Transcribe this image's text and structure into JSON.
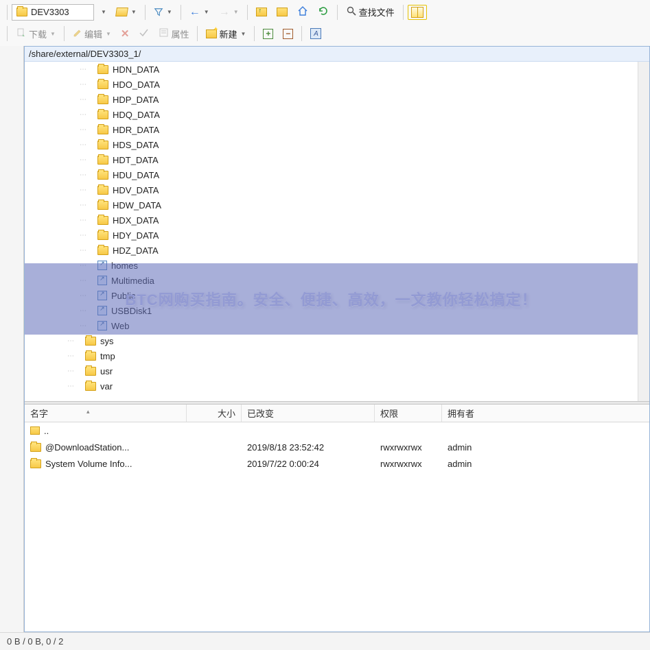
{
  "toolbar": {
    "path_dropdown": "DEV3303",
    "find_label": "查找文件",
    "download_label": "下载",
    "edit_label": "编辑",
    "props_label": "属性",
    "new_label": "新建",
    "a_label": "A"
  },
  "pathbar": "/share/external/DEV3303_1/",
  "tree": [
    {
      "type": "folder",
      "label": "HDN_DATA",
      "depth": 2
    },
    {
      "type": "folder",
      "label": "HDO_DATA",
      "depth": 2
    },
    {
      "type": "folder",
      "label": "HDP_DATA",
      "depth": 2
    },
    {
      "type": "folder",
      "label": "HDQ_DATA",
      "depth": 2
    },
    {
      "type": "folder",
      "label": "HDR_DATA",
      "depth": 2
    },
    {
      "type": "folder",
      "label": "HDS_DATA",
      "depth": 2
    },
    {
      "type": "folder",
      "label": "HDT_DATA",
      "depth": 2
    },
    {
      "type": "folder",
      "label": "HDU_DATA",
      "depth": 2
    },
    {
      "type": "folder",
      "label": "HDV_DATA",
      "depth": 2
    },
    {
      "type": "folder",
      "label": "HDW_DATA",
      "depth": 2
    },
    {
      "type": "folder",
      "label": "HDX_DATA",
      "depth": 2
    },
    {
      "type": "folder",
      "label": "HDY_DATA",
      "depth": 2
    },
    {
      "type": "folder",
      "label": "HDZ_DATA",
      "depth": 2
    },
    {
      "type": "link",
      "label": "homes",
      "depth": 2
    },
    {
      "type": "link",
      "label": "Multimedia",
      "depth": 2
    },
    {
      "type": "link",
      "label": "Public",
      "depth": 2
    },
    {
      "type": "link",
      "label": "USBDisk1",
      "depth": 2
    },
    {
      "type": "link",
      "label": "Web",
      "depth": 2
    },
    {
      "type": "folder",
      "label": "sys",
      "depth": 1
    },
    {
      "type": "folder",
      "label": "tmp",
      "depth": 1
    },
    {
      "type": "folder",
      "label": "usr",
      "depth": 1
    },
    {
      "type": "folder",
      "label": "var",
      "depth": 1
    }
  ],
  "watermark_text": "BTC网购买指南。安全、便捷、高效，一文教你轻松搞定！",
  "list": {
    "columns": {
      "name": "名字",
      "size": "大小",
      "changed": "已改变",
      "perm": "权限",
      "owner": "拥有者"
    },
    "rows": [
      {
        "type": "up",
        "name": ".."
      },
      {
        "type": "folder",
        "name": "@DownloadStation...",
        "changed": "2019/8/18 23:52:42",
        "perm": "rwxrwxrwx",
        "owner": "admin"
      },
      {
        "type": "folder",
        "name": "System Volume Info...",
        "changed": "2019/7/22 0:00:24",
        "perm": "rwxrwxrwx",
        "owner": "admin"
      }
    ]
  },
  "statusbar": "0 B / 0 B,   0 / 2"
}
